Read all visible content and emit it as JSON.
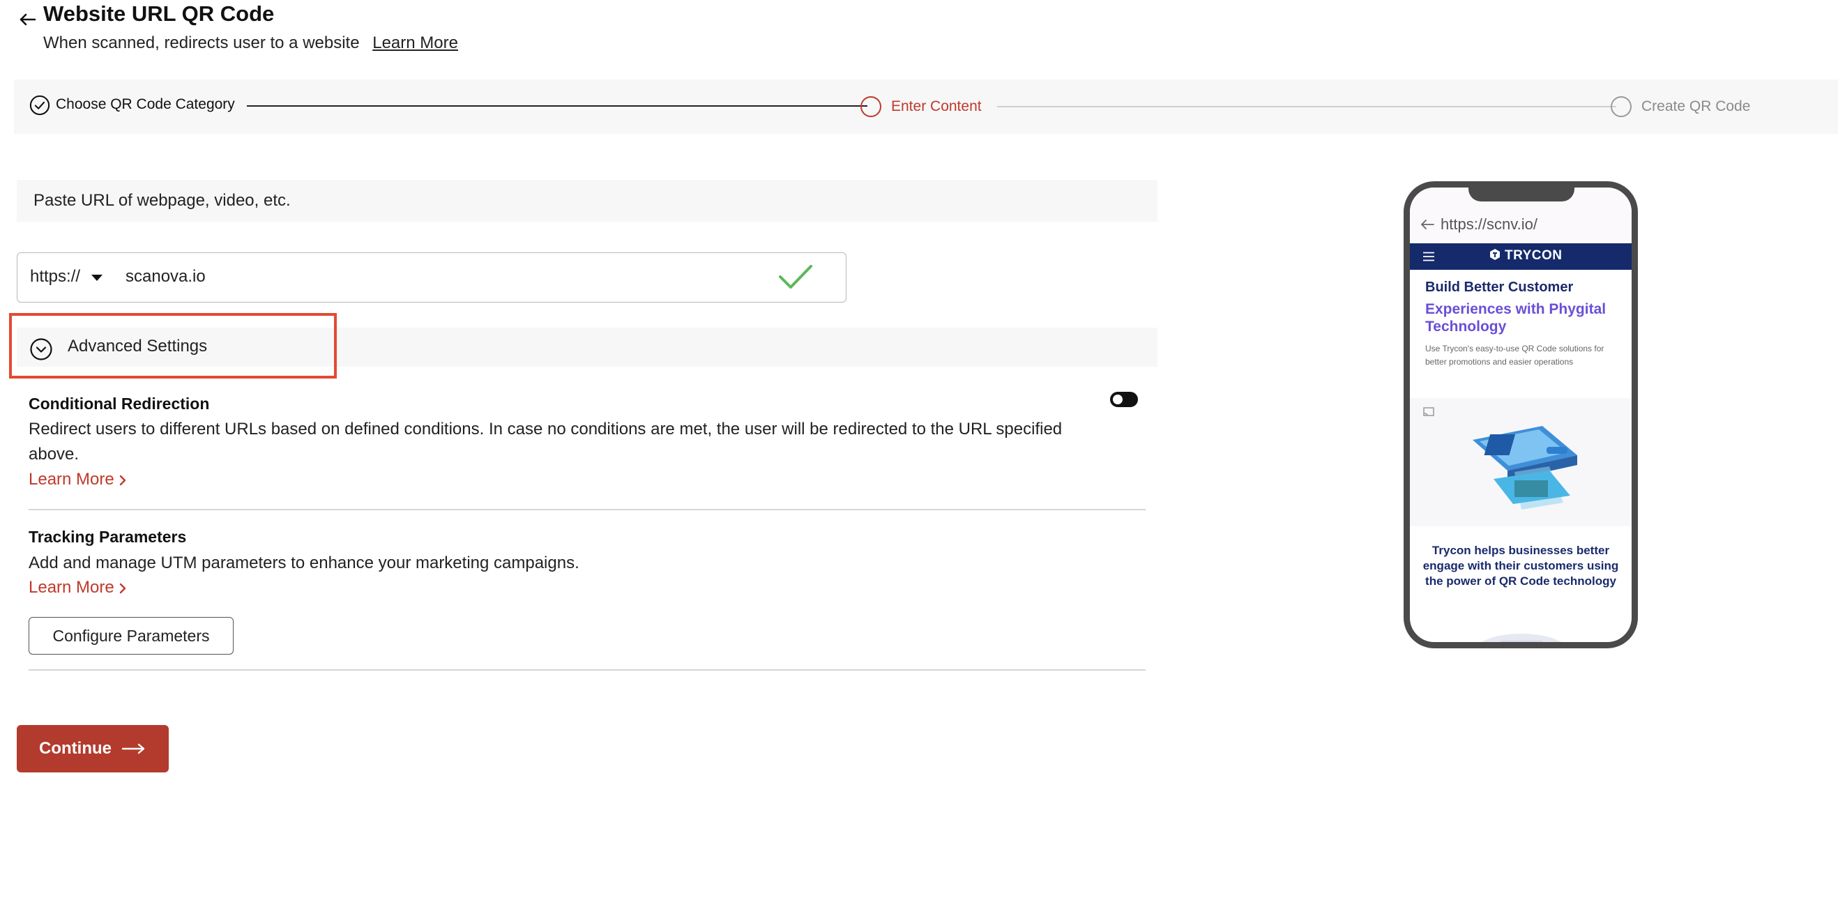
{
  "header": {
    "title": "Website URL QR Code",
    "subtitle": "When scanned, redirects user to a website",
    "learn_more": "Learn More"
  },
  "stepper": {
    "steps": [
      {
        "label": "Choose QR Code Category",
        "state": "done"
      },
      {
        "label": "Enter Content",
        "state": "active"
      },
      {
        "label": "Create QR Code",
        "state": "pending"
      }
    ]
  },
  "url_section": {
    "instruction": "Paste URL of webpage, video, etc.",
    "protocol": "https://",
    "url_value": "scanova.io"
  },
  "advanced": {
    "label": "Advanced Settings",
    "conditional": {
      "title": "Conditional Redirection",
      "description": "Redirect users to different URLs based on defined conditions. In case no conditions are met, the user will be redirected to the URL specified above.",
      "learn_more": "Learn More"
    },
    "tracking": {
      "title": "Tracking Parameters",
      "description": "Add and manage UTM parameters to enhance your marketing campaigns.",
      "learn_more": "Learn More",
      "configure_button": "Configure Parameters"
    }
  },
  "continue_button": "Continue",
  "preview": {
    "url": "https://scnv.io/",
    "brand": "TRYCON",
    "headline_1": "Build Better Customer",
    "headline_2": "Experiences with Phygital Technology",
    "subtext": "Use Trycon's easy-to-use QR Code solutions for better promotions and easier operations",
    "caption": "Trycon helps businesses better engage with their customers using the power of QR Code technology"
  },
  "colors": {
    "accent": "#b33b2e",
    "highlight": "#e24a33",
    "success": "#5cb85c",
    "nav": "#152a6b"
  }
}
